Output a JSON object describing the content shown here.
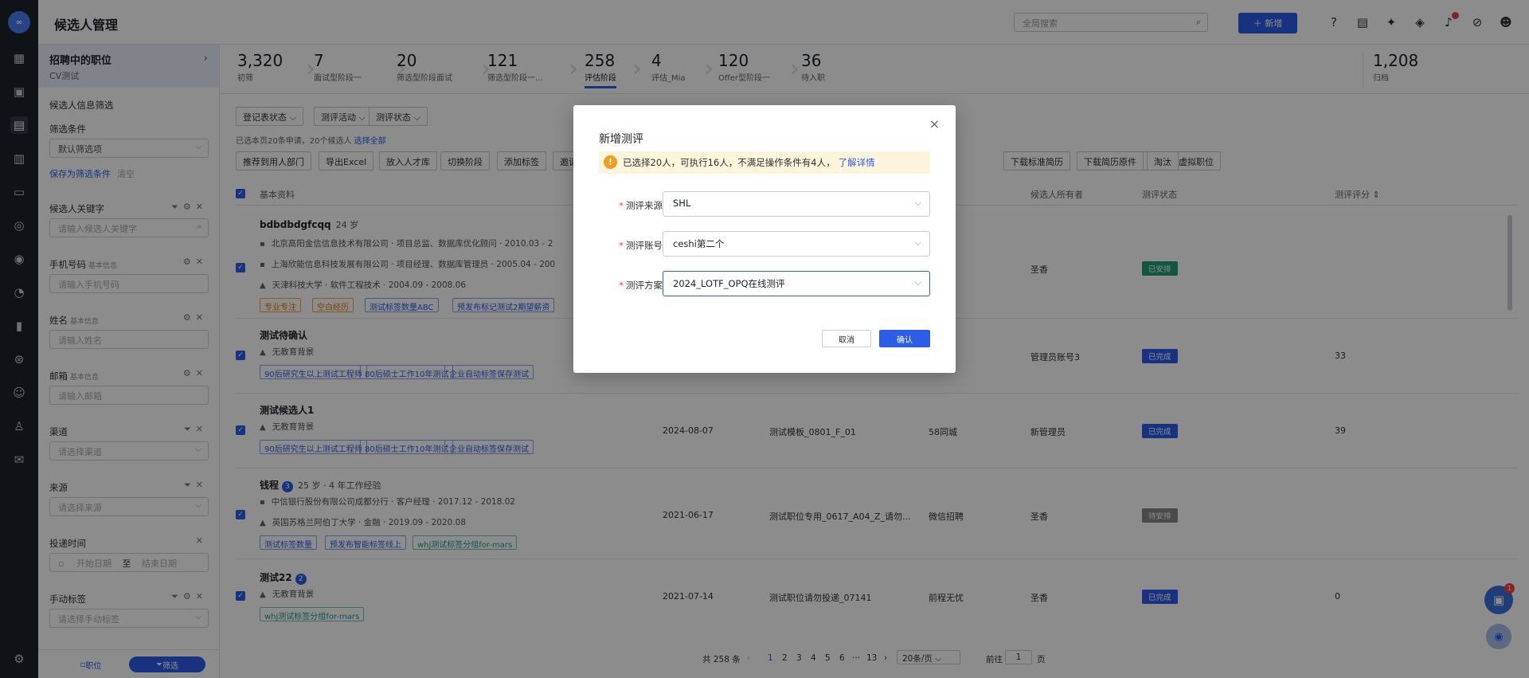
{
  "topbar": {
    "title": "候选人管理",
    "search_placeholder": "全局搜索",
    "new_button": "＋ 新增"
  },
  "sidebar": {
    "position_title": "招聘中的职位",
    "position_sub": "CV测试",
    "filter_section": "候选人信息筛选",
    "filter_cond": "筛选条件",
    "default_filter": "默认筛选项",
    "save_filter": "保存为筛选条件",
    "clear": "清空",
    "keyword_label": "候选人关键字",
    "keyword_placeholder": "请输入候选人关键字",
    "phone_label": "手机号码",
    "phone_tag": "基本信息",
    "phone_placeholder": "请输入手机号码",
    "name_label": "姓名",
    "name_tag": "基本信息",
    "name_placeholder": "请输入姓名",
    "email_label": "邮箱",
    "email_tag": "基本信息",
    "email_placeholder": "请输入邮箱",
    "channel_label": "渠道",
    "channel_placeholder": "请选择渠道",
    "source_label": "来源",
    "source_placeholder": "请选择来源",
    "time_label": "投递时间",
    "start_placeholder": "开始日期",
    "to": "至",
    "end_placeholder": "结束日期",
    "tag_label": "手动标签",
    "tag_placeholder": "请选择手动标签",
    "foot_position": "职位",
    "foot_filter": "筛选"
  },
  "stages": [
    {
      "num": "3,320",
      "label": "初筛"
    },
    {
      "num": "7",
      "label": "面试型阶段一"
    },
    {
      "num": "20",
      "label": "筛选型阶段面试"
    },
    {
      "num": "121",
      "label": "筛选型阶段一..."
    },
    {
      "num": "258",
      "label": "评估阶段"
    },
    {
      "num": "4",
      "label": "评估_Mia"
    },
    {
      "num": "120",
      "label": "Offer型阶段一"
    },
    {
      "num": "36",
      "label": "待入职"
    }
  ],
  "archive": {
    "num": "1,208",
    "label": "归档"
  },
  "filters": [
    "登记表状态 ⌵",
    "测评活动 ⌵",
    "测评状态 ⌵"
  ],
  "selection": {
    "text": "已选本页20条申请，20个候选人",
    "link": "选择全部"
  },
  "actions": [
    "推荐到用人部门",
    "导出Excel",
    "放入人才库",
    "切换阶段",
    "添加标签",
    "邀请",
    "转移到虚拟职位",
    "下载标准简历",
    "下载简历原件",
    "淘汰"
  ],
  "columns": {
    "basic": "基本资料",
    "owner": "候选人所有者",
    "status": "测评状态",
    "score": "测评评分 ⇕"
  },
  "rows": [
    {
      "name": "bdbdbdgfcqq",
      "meta": "24 岁",
      "lines": [
        "北京高阳金信信息技术有限公司 · 项目总监、数据库优化顾问 · 2010.03 - 2",
        "上海欣能信息科技发展有限公司 · 项目经理、数据库管理员 · 2005.04 - 200",
        "天津科技大学 · 软件工程技术 · 2004.09 - 2008.06"
      ],
      "tags": [
        "专业专注",
        "空白经历",
        "测试标签数量ABC",
        "预发布标记测试2期望薪资"
      ],
      "date": "",
      "template": "",
      "channel": "聘",
      "owner": "圣香",
      "status": "已安排",
      "score": ""
    },
    {
      "name": "测试待确认",
      "meta": "",
      "lines": [
        "无教育背景"
      ],
      "tags": [
        "90后研究生以上测试工程师",
        "80后硕士工作10年测试",
        "企业自动标签保存测试"
      ],
      "date": "",
      "template": "",
      "channel": "",
      "owner": "管理员账号3",
      "status": "已完成",
      "score": "33"
    },
    {
      "name": "测试候选人1",
      "meta": "",
      "lines": [
        "无教育背景"
      ],
      "tags": [
        "90后研究生以上测试工程师",
        "80后硕士工作10年测试",
        "企业自动标签保存测试"
      ],
      "date": "2024-08-07",
      "template": "测试模板_0801_F_01",
      "channel": "58同城",
      "owner": "新管理员",
      "status": "已完成",
      "score": "39"
    },
    {
      "name": "钱程",
      "badge": "3",
      "meta": "25 岁 · 4 年工作经验",
      "lines": [
        "中信银行股份有限公司成都分行 · 客户经理 · 2017.12 - 2018.02",
        "英国苏格兰阿伯丁大学 · 金融 · 2019.09 - 2020.08"
      ],
      "tags": [
        "测试标签数量",
        "预发布智能标签线上",
        "whj测试标签分组for-mars"
      ],
      "date": "2021-06-17",
      "template": "测试职位专用_0617_A04_Z_请勿...",
      "channel": "微信招聘",
      "owner": "圣香",
      "status": "待安排",
      "score": ""
    },
    {
      "name": "测试22",
      "badge": "2",
      "meta": "",
      "lines": [
        "无教育背景"
      ],
      "tags": [
        "whj测试标签分组for-mars"
      ],
      "date": "2021-07-14",
      "template": "测试职位请勿投递_07141",
      "channel": "前程无忧",
      "owner": "圣香",
      "status": "已完成",
      "score": "0"
    }
  ],
  "pager": {
    "total": "共 258 条",
    "prev": "‹",
    "pages": [
      "1",
      "2",
      "3",
      "4",
      "5",
      "6",
      "···",
      "13"
    ],
    "next": "›",
    "size": "20条/页 ⌵",
    "goto": "前往",
    "goto_val": "1",
    "page_unit": "页"
  },
  "fab_count": "1",
  "modal": {
    "title": "新增测评",
    "alert": "已选择20人，可执行16人，不满足操作条件有4人，",
    "alert_link": "了解详情",
    "source_label": "测评来源",
    "source_value": "SHL",
    "account_label": "测评账号",
    "account_value": "ceshi第二个",
    "plan_label": "测评方案",
    "plan_value": "2024_LOTF_OPQ在线测评",
    "cancel": "取消",
    "confirm": "确认"
  },
  "colors": {
    "accent": "#2b5de8",
    "rail": "#1d2129",
    "warn": "#f0a020",
    "done": "#2b5de8",
    "arranged": "#1f9b7a",
    "pending": "#888888"
  }
}
